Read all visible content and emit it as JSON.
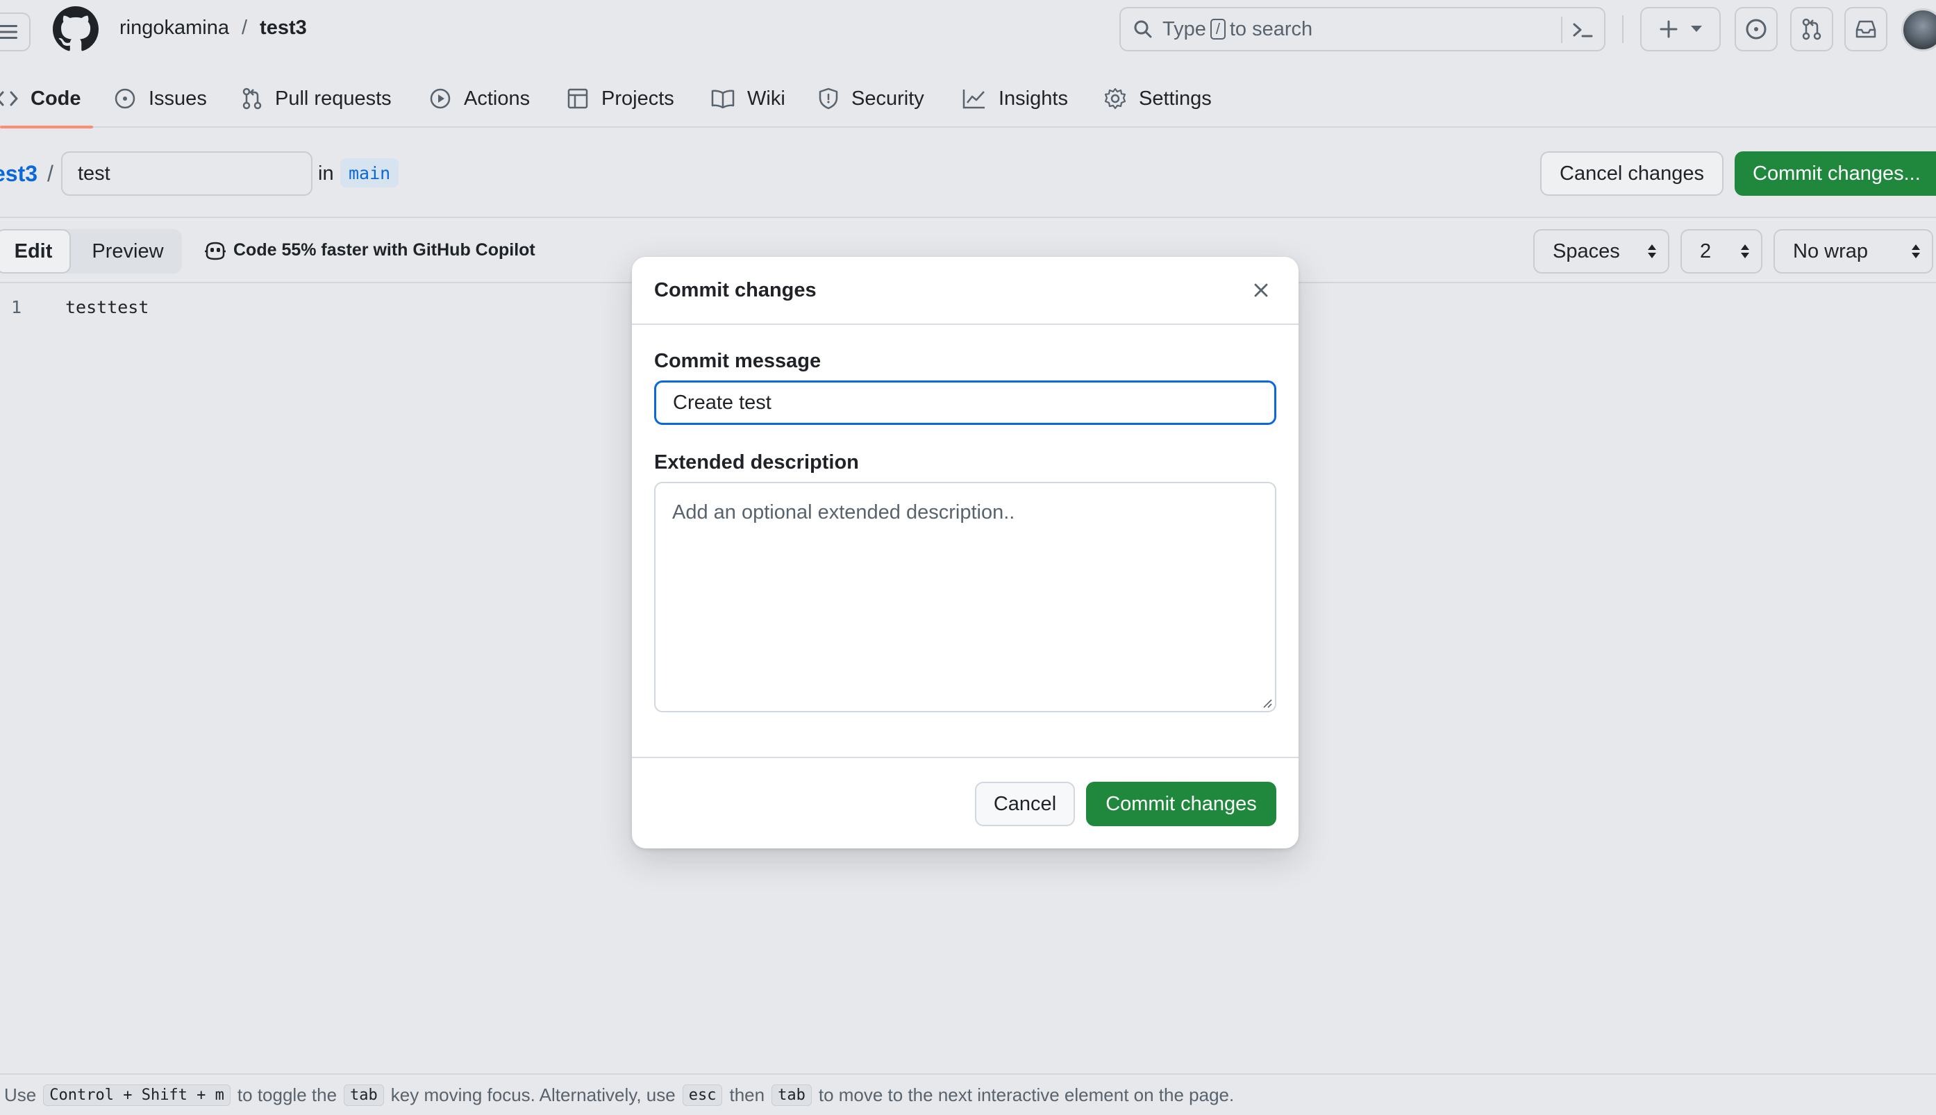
{
  "header": {
    "owner": "ringokamina",
    "separator": "/",
    "repo": "test3",
    "search": {
      "prefix": "Type",
      "key": "/",
      "suffix": "to search"
    },
    "icons": [
      "hamburger-icon",
      "github-logo-icon",
      "search-icon",
      "command-palette-icon",
      "plus-icon",
      "triangle-down-icon",
      "issue-opened-icon",
      "git-pull-request-icon",
      "inbox-icon",
      "avatar"
    ]
  },
  "repo_nav": {
    "items": [
      {
        "label": "Code",
        "icon": "code-icon",
        "active": true
      },
      {
        "label": "Issues",
        "icon": "issue-opened-icon"
      },
      {
        "label": "Pull requests",
        "icon": "git-pull-request-icon"
      },
      {
        "label": "Actions",
        "icon": "play-icon"
      },
      {
        "label": "Projects",
        "icon": "table-icon"
      },
      {
        "label": "Wiki",
        "icon": "book-icon"
      },
      {
        "label": "Security",
        "icon": "shield-icon"
      },
      {
        "label": "Insights",
        "icon": "graph-icon"
      },
      {
        "label": "Settings",
        "icon": "gear-icon"
      }
    ]
  },
  "file_bar": {
    "repo_crumb": "est3",
    "crumb_separator": "/",
    "filename": "test",
    "in_label": "in",
    "branch": "main",
    "cancel_label": "Cancel changes",
    "commit_label": "Commit changes..."
  },
  "editor_toolbar": {
    "edit_tab": "Edit",
    "preview_tab": "Preview",
    "copilot_tip": "Code 55% faster with GitHub Copilot",
    "indent_mode": "Spaces",
    "indent_size": "2",
    "wrap_mode": "No wrap"
  },
  "editor": {
    "lines": [
      {
        "number": "1",
        "text": "testtest"
      }
    ]
  },
  "dialog": {
    "title": "Commit changes",
    "message_label": "Commit message",
    "message_value": "Create test",
    "description_label": "Extended description",
    "description_placeholder": "Add an optional extended description..",
    "cancel_label": "Cancel",
    "commit_label": "Commit changes"
  },
  "footer": {
    "t1": "Use",
    "k1": "Control + Shift + m",
    "t2": "to toggle the",
    "k2": "tab",
    "t3": "key moving focus. Alternatively, use",
    "k3": "esc",
    "t4": "then",
    "k4": "tab",
    "t5": "to move to the next interactive element on the page."
  },
  "colors": {
    "accent_blue": "#0969da",
    "primary_green": "#1f883d",
    "nav_underline": "#fd8c73",
    "background": "#e6e8eb"
  }
}
